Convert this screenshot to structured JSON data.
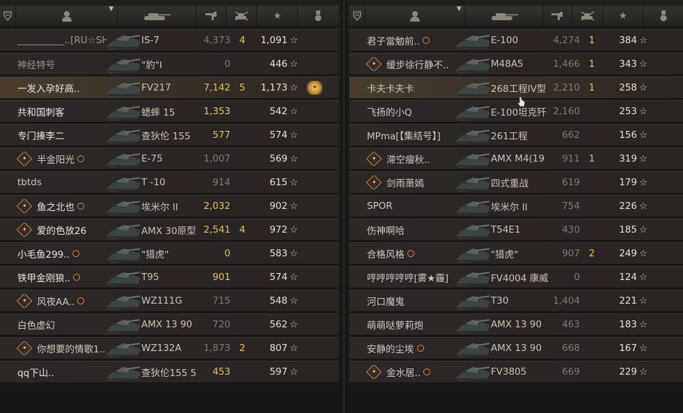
{
  "header_icons": {
    "squad": "squad-icon",
    "player": "player-icon",
    "vehicle": "tank-icon",
    "damage": "damage-icon",
    "kills": "kills-icon",
    "xp": "star-icon",
    "medal": "medal-icon"
  },
  "star_glyph": "☆",
  "left_team": [
    {
      "squad": false,
      "net": false,
      "name": "__________..[RU☆SH]",
      "vehicle": "IS-7",
      "damage": "4,373",
      "damage_gold": false,
      "kills": "4",
      "xp": "1,091",
      "medal": false,
      "tone": "dim"
    },
    {
      "squad": false,
      "net": false,
      "name": "神经特号",
      "vehicle": "\"豹\"I",
      "damage": "0",
      "damage_gold": false,
      "kills": "",
      "xp": "446",
      "medal": false,
      "tone": "dim"
    },
    {
      "squad": false,
      "net": false,
      "name": "一发入孕好高..",
      "vehicle": "FV217",
      "damage": "7,142",
      "damage_gold": true,
      "kills": "5",
      "xp": "1,173",
      "medal": true,
      "tone": "bright",
      "highlight": true
    },
    {
      "squad": false,
      "net": false,
      "name": "共和国刺客",
      "vehicle": "蟋蟀 15",
      "damage": "1,353",
      "damage_gold": true,
      "kills": "",
      "xp": "542",
      "medal": false,
      "tone": "bright"
    },
    {
      "squad": false,
      "net": false,
      "name": "专门揍李二",
      "vehicle": "查狄伦 155",
      "damage": "577",
      "damage_gold": true,
      "kills": "",
      "xp": "574",
      "medal": false,
      "tone": "bright"
    },
    {
      "squad": true,
      "net": true,
      "name": "半金阳光",
      "vehicle": "E-75",
      "damage": "1,007",
      "damage_gold": false,
      "kills": "",
      "xp": "569",
      "medal": false,
      "tone": "normal"
    },
    {
      "squad": false,
      "net": false,
      "name": "tbtds",
      "vehicle": "T -10",
      "damage": "914",
      "damage_gold": false,
      "kills": "",
      "xp": "615",
      "medal": false,
      "tone": "normal"
    },
    {
      "squad": true,
      "net": true,
      "name": "鱼之北也",
      "vehicle": "埃米尔 II",
      "damage": "2,032",
      "damage_gold": true,
      "kills": "",
      "xp": "902",
      "medal": false,
      "tone": "bright"
    },
    {
      "squad": true,
      "net": false,
      "name": "爱的色放26",
      "vehicle": "AMX 30原型",
      "damage": "2,541",
      "damage_gold": true,
      "kills": "4",
      "xp": "972",
      "medal": false,
      "tone": "bright"
    },
    {
      "squad": false,
      "net": true,
      "name": "小毛鱼299..",
      "vehicle": "\"猎虎\"",
      "damage": "0",
      "damage_gold": true,
      "kills": "",
      "xp": "583",
      "medal": false,
      "tone": "bright"
    },
    {
      "squad": false,
      "net": true,
      "name": "铁甲金刚狼..",
      "vehicle": "T95",
      "damage": "901",
      "damage_gold": true,
      "kills": "",
      "xp": "574",
      "medal": false,
      "tone": "bright"
    },
    {
      "squad": true,
      "net": true,
      "name": "风夜AA..",
      "vehicle": "WZ111G",
      "damage": "715",
      "damage_gold": false,
      "kills": "",
      "xp": "548",
      "medal": false,
      "tone": "normal"
    },
    {
      "squad": false,
      "net": false,
      "name": "白色虚幻",
      "vehicle": "AMX 13 90",
      "damage": "720",
      "damage_gold": false,
      "kills": "",
      "xp": "562",
      "medal": false,
      "tone": "normal"
    },
    {
      "squad": true,
      "net": false,
      "name": "你想要的情歌1..",
      "vehicle": "WZ132A",
      "damage": "1,873",
      "damage_gold": false,
      "kills": "2",
      "xp": "807",
      "medal": false,
      "tone": "normal"
    },
    {
      "squad": false,
      "net": false,
      "name": "qq下山..",
      "vehicle": "查狄伦155 5",
      "damage": "453",
      "damage_gold": true,
      "kills": "",
      "xp": "597",
      "medal": false,
      "tone": "bright"
    }
  ],
  "right_team": [
    {
      "squad": false,
      "net": true,
      "name": "君子當勉前..",
      "vehicle": "E-100",
      "damage": "4,274",
      "damage_gold": false,
      "kills": "1",
      "xp": "384",
      "tone": "normal"
    },
    {
      "squad": true,
      "net": false,
      "name": "缓步徐行静不..",
      "vehicle": "M48A5",
      "damage": "1,466",
      "damage_gold": false,
      "kills": "1",
      "xp": "343",
      "tone": "normal"
    },
    {
      "squad": false,
      "net": false,
      "name": "卡夫卡夫卡",
      "vehicle": "268工程IV型",
      "damage": "2,210",
      "damage_gold": false,
      "kills": "1",
      "xp": "258",
      "tone": "normal",
      "highlight": true
    },
    {
      "squad": false,
      "net": false,
      "name": "飞扬的小Q",
      "vehicle": "E-100坦克歼",
      "damage": "2,160",
      "damage_gold": false,
      "kills": "",
      "xp": "253",
      "tone": "normal"
    },
    {
      "squad": false,
      "net": false,
      "name": "MPma[【集结号】]",
      "vehicle": "261工程",
      "damage": "662",
      "damage_gold": false,
      "kills": "",
      "xp": "156",
      "tone": "normal"
    },
    {
      "squad": true,
      "net": false,
      "name": "滞空瘤秋..",
      "vehicle": "AMX M4(19",
      "damage": "911",
      "damage_gold": false,
      "kills": "1",
      "xp": "319",
      "tone": "normal"
    },
    {
      "squad": true,
      "net": false,
      "name": "剑雨萧嫣",
      "vehicle": "四式重战",
      "damage": "619",
      "damage_gold": false,
      "kills": "",
      "xp": "179",
      "tone": "normal"
    },
    {
      "squad": false,
      "net": false,
      "name": "SPOR",
      "vehicle": "埃米尔 II",
      "damage": "754",
      "damage_gold": false,
      "kills": "",
      "xp": "226",
      "tone": "normal"
    },
    {
      "squad": false,
      "net": false,
      "name": "伤神啊哈",
      "vehicle": "T54E1",
      "damage": "430",
      "damage_gold": false,
      "kills": "",
      "xp": "185",
      "tone": "normal"
    },
    {
      "squad": false,
      "net": true,
      "name": "合格风格",
      "vehicle": "\"猎虎\"",
      "damage": "907",
      "damage_gold": false,
      "kills": "2",
      "xp": "249",
      "tone": "normal"
    },
    {
      "squad": false,
      "net": false,
      "name": "哼哼哼哼哼[雾★霾]",
      "vehicle": "FV4004 康威",
      "damage": "0",
      "damage_gold": false,
      "kills": "",
      "xp": "124",
      "tone": "normal"
    },
    {
      "squad": false,
      "net": false,
      "name": "河口魔鬼",
      "vehicle": "T30",
      "damage": "1,404",
      "damage_gold": false,
      "kills": "",
      "xp": "221",
      "tone": "normal"
    },
    {
      "squad": false,
      "net": false,
      "name": "萌萌哒萝莉炮",
      "vehicle": "AMX 13 90",
      "damage": "463",
      "damage_gold": false,
      "kills": "",
      "xp": "183",
      "tone": "normal"
    },
    {
      "squad": false,
      "net": true,
      "name": "安静的尘埃",
      "vehicle": "AMX 13 90",
      "damage": "668",
      "damage_gold": false,
      "kills": "",
      "xp": "167",
      "tone": "normal"
    },
    {
      "squad": true,
      "net": true,
      "name": "金水居..",
      "vehicle": "FV3805",
      "damage": "669",
      "damage_gold": false,
      "kills": "",
      "xp": "229",
      "tone": "normal"
    }
  ]
}
